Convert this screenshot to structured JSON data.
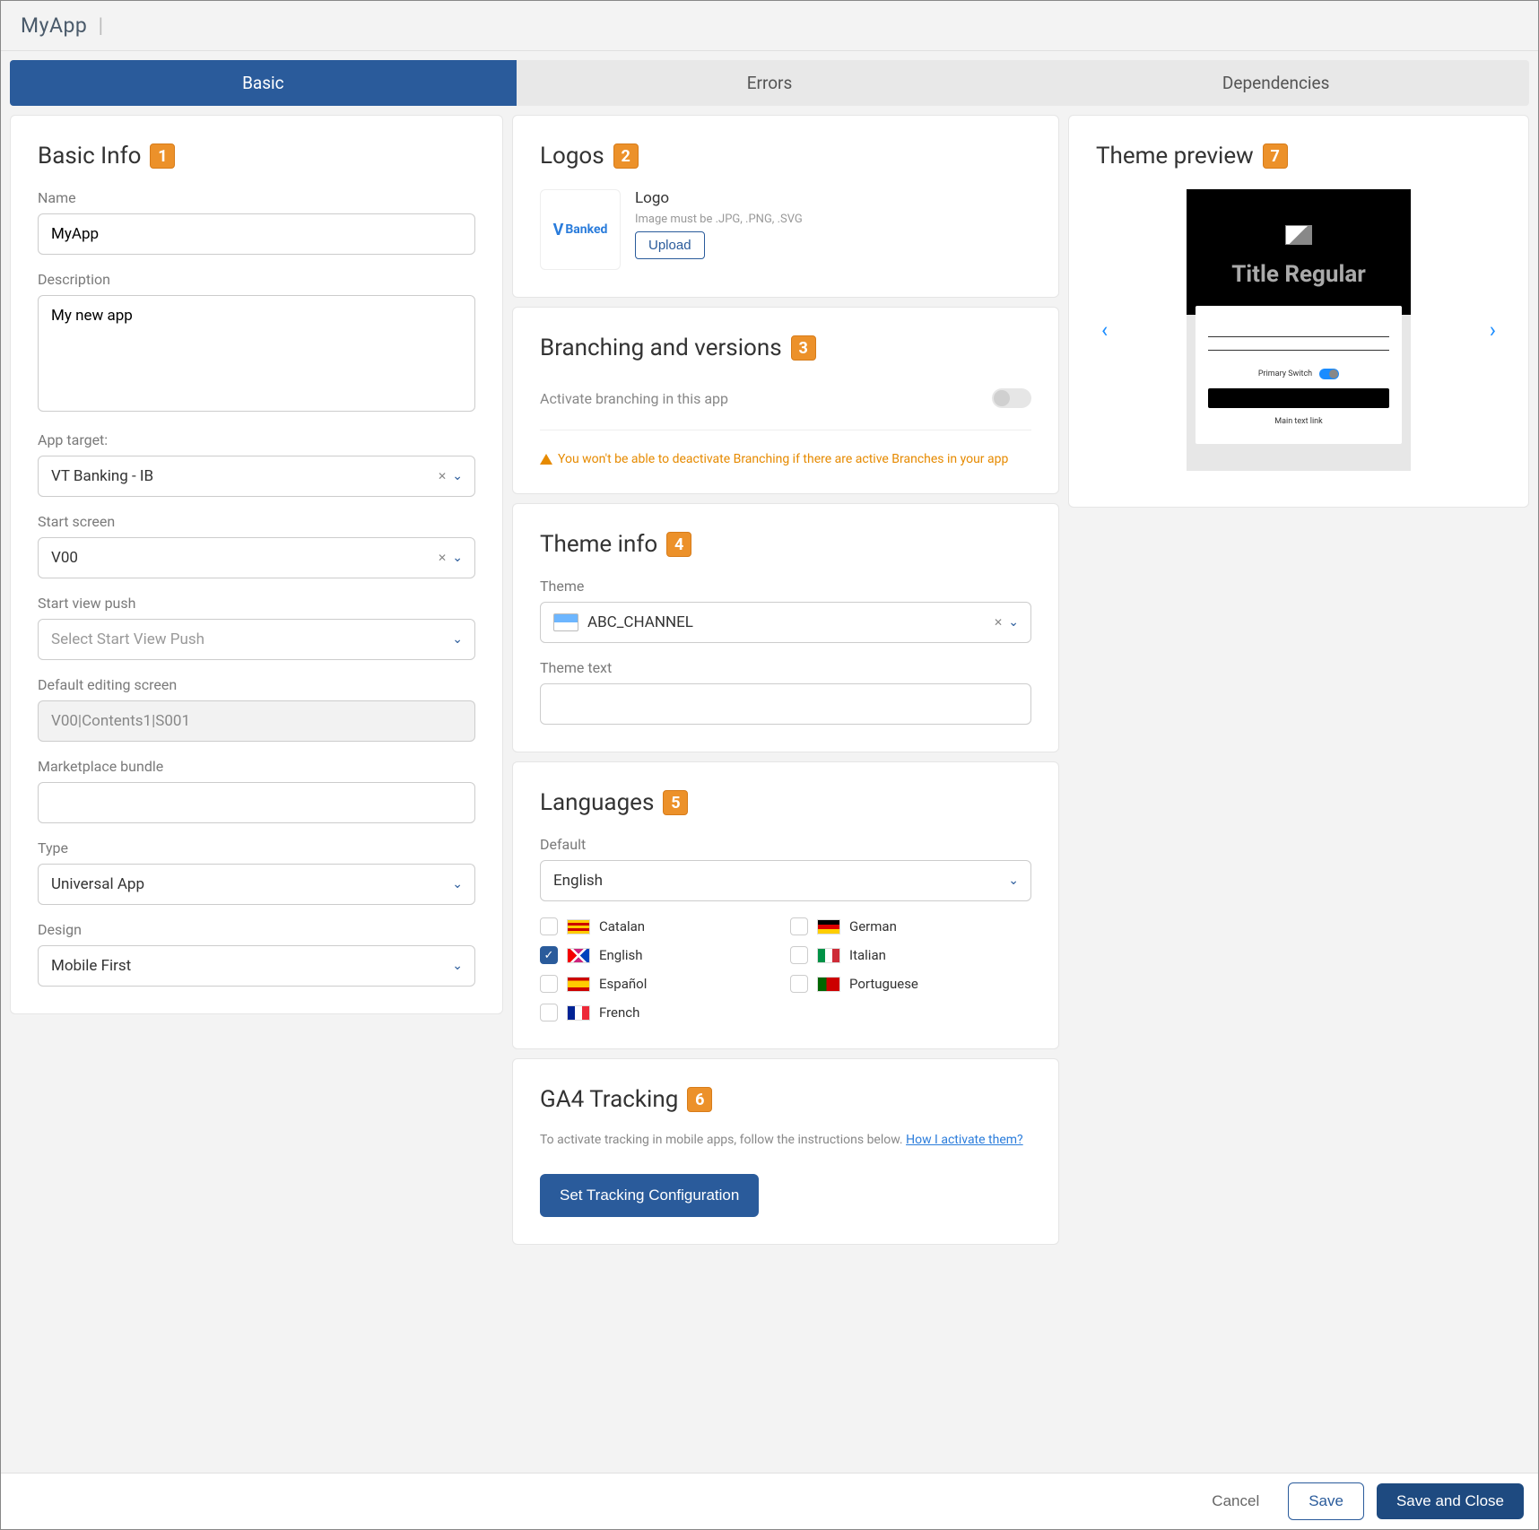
{
  "header": {
    "title": "MyApp"
  },
  "tabs": {
    "basic": "Basic",
    "errors": "Errors",
    "dependencies": "Dependencies"
  },
  "basicInfo": {
    "section_title": "Basic Info",
    "badge": "1",
    "name_label": "Name",
    "name_value": "MyApp",
    "description_label": "Description",
    "description_value": "My new app",
    "app_target_label": "App target:",
    "app_target_value": "VT Banking - IB",
    "start_screen_label": "Start screen",
    "start_screen_value": "V00",
    "start_view_push_label": "Start view push",
    "start_view_push_placeholder": "Select Start View Push",
    "default_editing_label": "Default editing screen",
    "default_editing_value": "V00|Contents1|S001",
    "marketplace_label": "Marketplace bundle",
    "type_label": "Type",
    "type_value": "Universal App",
    "design_label": "Design",
    "design_value": "Mobile First"
  },
  "logos": {
    "section_title": "Logos",
    "badge": "2",
    "logo_thumb_text": "Banked",
    "name": "Logo",
    "req": "Image must be .JPG, .PNG, .SVG",
    "upload": "Upload"
  },
  "branching": {
    "section_title": "Branching and versions",
    "badge": "3",
    "activate_label": "Activate branching in this app",
    "warn": "You won't be able to deactivate Branching if there are active Branches in your app"
  },
  "themeInfo": {
    "section_title": "Theme info",
    "badge": "4",
    "theme_label": "Theme",
    "theme_value": "ABC_CHANNEL",
    "theme_text_label": "Theme text"
  },
  "languages": {
    "section_title": "Languages",
    "badge": "5",
    "default_label": "Default",
    "default_value": "English",
    "items": {
      "catalan": "Catalan",
      "german": "German",
      "english": "English",
      "italian": "Italian",
      "espanol": "Español",
      "portuguese": "Portuguese",
      "french": "French"
    }
  },
  "ga4": {
    "section_title": "GA4 Tracking",
    "badge": "6",
    "desc": "To activate tracking in mobile apps, follow the instructions below. ",
    "link": "How I activate them?",
    "button": "Set Tracking Configuration"
  },
  "preview": {
    "section_title": "Theme preview",
    "badge": "7",
    "title": "Title Regular",
    "switch_label": "Primary Switch",
    "link_text": "Main text link"
  },
  "footer": {
    "cancel": "Cancel",
    "save": "Save",
    "save_close": "Save and Close"
  }
}
